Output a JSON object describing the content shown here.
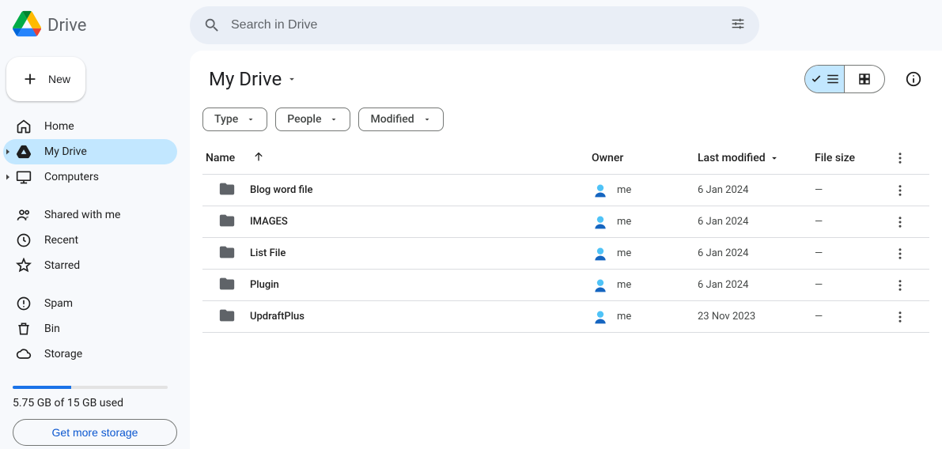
{
  "header": {
    "app_title": "Drive",
    "search_placeholder": "Search in Drive"
  },
  "sidebar": {
    "new_label": "New",
    "nav1": [
      {
        "label": "Home"
      },
      {
        "label": "My Drive"
      },
      {
        "label": "Computers"
      }
    ],
    "nav2": [
      {
        "label": "Shared with me"
      },
      {
        "label": "Recent"
      },
      {
        "label": "Starred"
      }
    ],
    "nav3": [
      {
        "label": "Spam"
      },
      {
        "label": "Bin"
      },
      {
        "label": "Storage"
      }
    ],
    "storage_text": "5.75 GB of 15 GB used",
    "storage_percent": 38,
    "storage_cta": "Get more storage"
  },
  "main": {
    "path": "My Drive",
    "chips": [
      "Type",
      "People",
      "Modified"
    ],
    "columns": {
      "name": "Name",
      "owner": "Owner",
      "modified": "Last modified",
      "size": "File size"
    },
    "rows": [
      {
        "name": "Blog word file",
        "owner": "me",
        "modified": "6 Jan 2024",
        "size": "—"
      },
      {
        "name": "IMAGES",
        "owner": "me",
        "modified": "6 Jan 2024",
        "size": "—"
      },
      {
        "name": "List File",
        "owner": "me",
        "modified": "6 Jan 2024",
        "size": "—"
      },
      {
        "name": "Plugin",
        "owner": "me",
        "modified": "6 Jan 2024",
        "size": "—"
      },
      {
        "name": "UpdraftPlus",
        "owner": "me",
        "modified": "23 Nov 2023",
        "size": "—"
      }
    ]
  }
}
